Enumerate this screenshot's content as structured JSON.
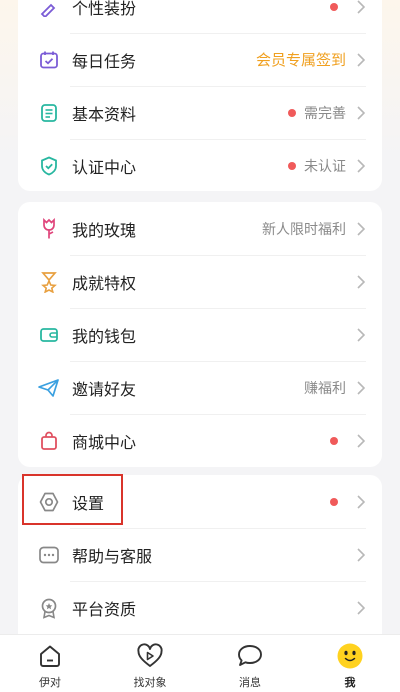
{
  "menu_group_1": {
    "items": [
      {
        "label": "个性装扮",
        "right_text": "",
        "dot": true
      },
      {
        "label": "每日任务",
        "right_text": "会员专属签到",
        "dot": false
      },
      {
        "label": "基本资料",
        "right_text": "需完善",
        "dot": true
      },
      {
        "label": "认证中心",
        "right_text": "未认证",
        "dot": true
      }
    ]
  },
  "menu_group_2": {
    "items": [
      {
        "label": "我的玫瑰",
        "right_text": "新人限时福利",
        "dot": false
      },
      {
        "label": "成就特权",
        "right_text": "",
        "dot": false
      },
      {
        "label": "我的钱包",
        "right_text": "",
        "dot": false
      },
      {
        "label": "邀请好友",
        "right_text": "赚福利",
        "dot": false
      },
      {
        "label": "商城中心",
        "right_text": "",
        "dot": true
      }
    ]
  },
  "menu_group_3": {
    "items": [
      {
        "label": "设置",
        "right_text": "",
        "dot": true
      },
      {
        "label": "帮助与客服",
        "right_text": "",
        "dot": false
      },
      {
        "label": "平台资质",
        "right_text": "",
        "dot": false
      }
    ]
  },
  "tabbar": {
    "tabs": [
      {
        "label": "伊对",
        "icon": "home-icon"
      },
      {
        "label": "找对象",
        "icon": "heart-play-icon"
      },
      {
        "label": "消息",
        "icon": "chat-bubble-icon"
      },
      {
        "label": "我",
        "icon": "smiley-avatar-icon",
        "active": true
      }
    ]
  },
  "colors": {
    "accent_gold": "#f0a020",
    "dot_red": "#f05a5a",
    "highlight_red": "#d9342b",
    "icon_purple": "#7b5cd6",
    "icon_teal": "#28b7a0",
    "icon_pink": "#e0457b",
    "icon_orange": "#e8a040"
  }
}
